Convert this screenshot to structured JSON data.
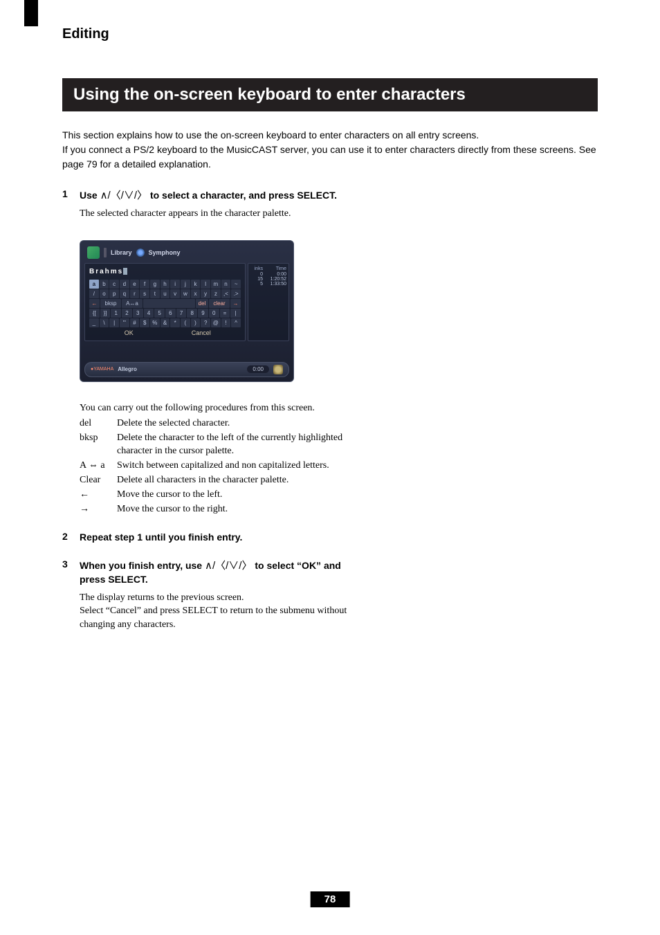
{
  "chapter": "Editing",
  "hero": "Using the on-screen keyboard to enter characters",
  "intro_l1": "This section explains how to use the on-screen keyboard to enter characters on all entry screens.",
  "intro_l2": "If you connect a PS/2 keyboard to the MusicCAST server, you can use it to enter characters directly from these screens. See page 79 for a detailed explanation.",
  "steps": {
    "s1": {
      "num": "1",
      "title_a": "Use ",
      "arrows": "∧/〈/∨/〉",
      "title_b": " to select a character, and press SELECT.",
      "body": "The selected character appears in the character palette."
    },
    "carry": "You can carry out the following procedures from this screen.",
    "defs": {
      "del": {
        "t": "del",
        "d": "Delete the selected character."
      },
      "bksp": {
        "t": "bksp",
        "d": "Delete the character to the left of the currently highlighted character in the cursor palette."
      },
      "case": {
        "t": "A ⇔ a",
        "d": "Switch between capitalized and non capitalized letters."
      },
      "clear": {
        "t": "Clear",
        "d": "Delete all characters in the character palette."
      },
      "left": {
        "t": "←",
        "d": "Move the cursor to the left."
      },
      "right": {
        "t": "→",
        "d": "Move the cursor to the right."
      }
    },
    "s2": {
      "num": "2",
      "title": "Repeat step 1 until you finish entry."
    },
    "s3": {
      "num": "3",
      "title_a": "When you finish entry, use ",
      "arrows": "∧/〈/∨/〉",
      "title_b": " to select “OK” and press SELECT.",
      "body1": "The display returns to the previous screen.",
      "body2": "Select “Cancel” and press SELECT to return to the submenu without changing any characters."
    }
  },
  "screenshot": {
    "library": "Library",
    "category": "Symphony",
    "entry": "Brahms",
    "row1": [
      "a",
      "b",
      "c",
      "d",
      "e",
      "f",
      "g",
      "h",
      "i",
      "j",
      "k",
      "l",
      "m",
      "n",
      "~"
    ],
    "row2": [
      "/",
      "o",
      "p",
      "q",
      "r",
      "s",
      "t",
      "u",
      "v",
      "w",
      "x",
      "y",
      "z",
      ",<",
      ".>"
    ],
    "row3": [
      "←",
      "bksp",
      "A↔a",
      " ",
      "del",
      "clear",
      "→"
    ],
    "row4": [
      "{[",
      "}]",
      "1",
      "2",
      "3",
      "4",
      "5",
      "6",
      "7",
      "8",
      "9",
      "0",
      "=",
      "|"
    ],
    "row5": [
      "_",
      "\\",
      "|",
      "\"'",
      "#",
      "$",
      "%",
      "&",
      "*",
      "(",
      ")",
      "?",
      "@",
      "!",
      "^"
    ],
    "ok": "OK",
    "cancel": "Cancel",
    "side_h1": "inks",
    "side_h2": "Time",
    "tracks": [
      {
        "n": "0",
        "t": "0:00"
      },
      {
        "n": "15",
        "t": "1:20:52"
      },
      {
        "n": "5",
        "t": "1:33:50"
      }
    ],
    "status_brand": "YAMAHA",
    "status_piece": "Allegro",
    "status_time": "0:00"
  },
  "page": "78"
}
